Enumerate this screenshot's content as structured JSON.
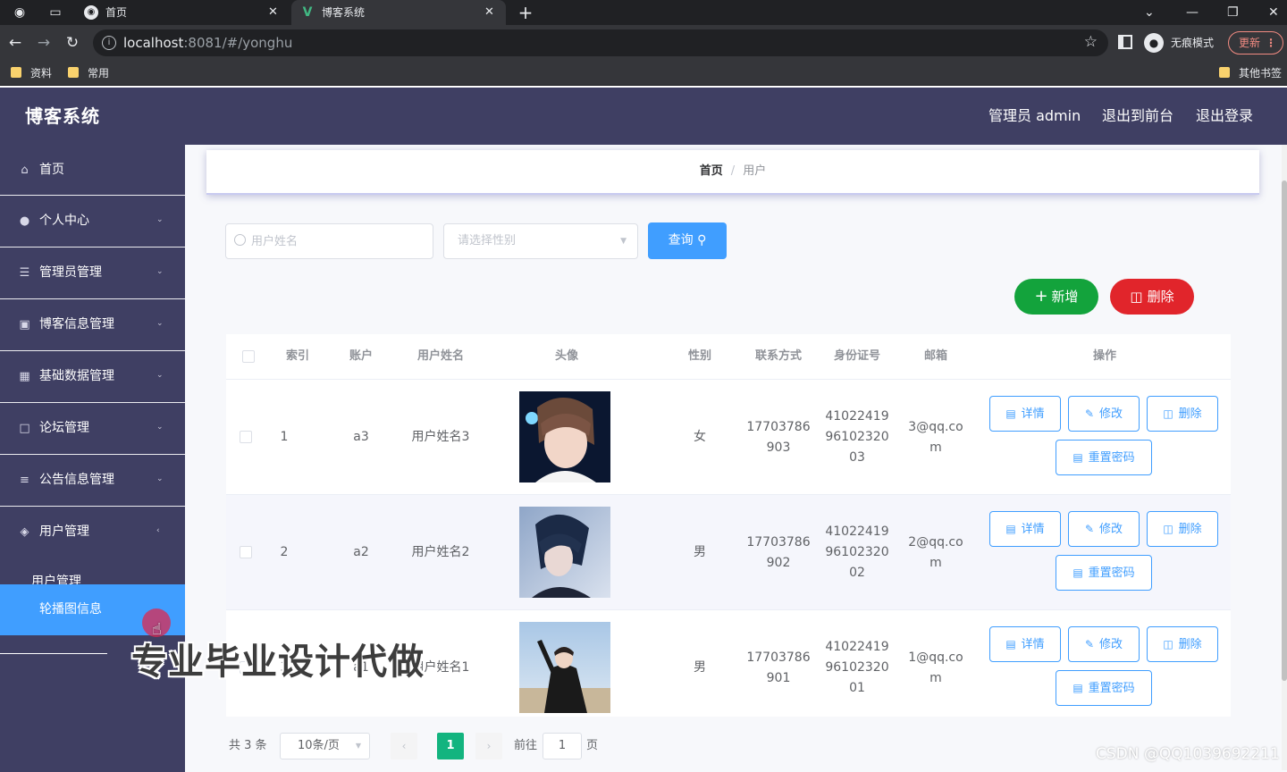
{
  "browser": {
    "tabs": [
      {
        "title": "首页",
        "active": false
      },
      {
        "title": "博客系统",
        "active": true
      }
    ],
    "new_tab_glyph": "+",
    "url_host": "localhost",
    "url_rest": ":8081/#/yonghu",
    "incognito_label": "无痕模式",
    "update_label": "更新",
    "bookmarks": [
      "资料",
      "常用"
    ],
    "other_bookmarks": "其他书签"
  },
  "header": {
    "brand": "博客系统",
    "admin_label": "管理员 admin",
    "to_front_label": "退出到前台",
    "logout_label": "退出登录"
  },
  "sidebar": {
    "items": [
      {
        "label": "首页",
        "icon": "home-icon"
      },
      {
        "label": "个人中心",
        "icon": "user-icon"
      },
      {
        "label": "管理员管理",
        "icon": "sliders-icon"
      },
      {
        "label": "博客信息管理",
        "icon": "clipboard-icon"
      },
      {
        "label": "基础数据管理",
        "icon": "grid-icon"
      },
      {
        "label": "论坛管理",
        "icon": "chat-icon"
      },
      {
        "label": "公告信息管理",
        "icon": "list-icon"
      },
      {
        "label": "用户管理",
        "icon": "shield-icon"
      }
    ],
    "submenu": [
      {
        "label": "用户管理",
        "active": false
      },
      {
        "label": "轮播图信息",
        "active": true
      }
    ]
  },
  "breadcrumb": {
    "home": "首页",
    "separator": "/",
    "current": "用户"
  },
  "search": {
    "name_placeholder": "用户姓名",
    "gender_placeholder": "请选择性别",
    "query_label": "查询"
  },
  "actions": {
    "add_label": "新增",
    "delete_label": "删除"
  },
  "table": {
    "columns": [
      "索引",
      "账户",
      "用户姓名",
      "头像",
      "性别",
      "联系方式",
      "身份证号",
      "邮箱",
      "操作"
    ],
    "rows": [
      {
        "index": "1",
        "account": "a3",
        "name": "用户姓名3",
        "gender": "女",
        "phone": [
          "17703786",
          "903"
        ],
        "id_card": [
          "41022419",
          "96102320",
          "03"
        ],
        "email": [
          "3@qq.co",
          "m"
        ]
      },
      {
        "index": "2",
        "account": "a2",
        "name": "用户姓名2",
        "gender": "男",
        "phone": [
          "17703786",
          "902"
        ],
        "id_card": [
          "41022419",
          "96102320",
          "02"
        ],
        "email": [
          "2@qq.co",
          "m"
        ]
      },
      {
        "index": "3",
        "account": "a1",
        "name": "用户姓名1",
        "gender": "男",
        "phone": [
          "17703786",
          "901"
        ],
        "id_card": [
          "41022419",
          "96102320",
          "01"
        ],
        "email": [
          "1@qq.co",
          "m"
        ]
      }
    ],
    "row_actions": {
      "detail": "详情",
      "edit": "修改",
      "delete": "删除",
      "reset_password": "重置密码"
    }
  },
  "pagination": {
    "total_label": "共 3 条",
    "page_size": "10条/页",
    "current_page": "1",
    "goto_label": "前往",
    "goto_value": "1",
    "page_suffix": "页"
  },
  "overlays": {
    "watermark": "专业毕业设计代做",
    "csdn": "CSDN @QQ1039692211"
  },
  "colors": {
    "sidebar_bg": "#3f3f63",
    "primary": "#409eff",
    "success": "#13a33c",
    "danger": "#e1252b",
    "pager_active": "#13b47f"
  }
}
